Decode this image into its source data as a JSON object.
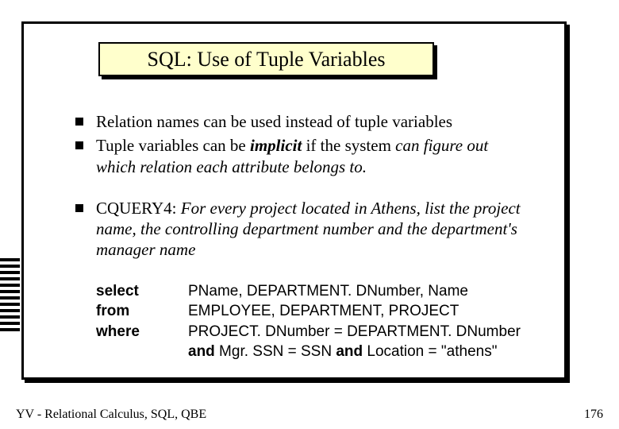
{
  "title": "SQL: Use of Tuple Variables",
  "bullets": {
    "b1": "Relation names can be used instead of tuple variables",
    "b2a": "Tuple variables can be ",
    "b2b": "implicit",
    "b2c": "  if the system ",
    "b2d": "can figure out which relation each attribute belongs to.",
    "b3a": "CQUERY4:   ",
    "b3b": "For every project located in Athens, list the project name, the controlling department number  and the department's manager name"
  },
  "sql": {
    "k_select": "select",
    "k_from": "from",
    "k_where": "where",
    "v_select": "PName, DEPARTMENT. DNumber, Name",
    "v_from": "EMPLOYEE, DEPARTMENT, PROJECT",
    "v_where1": "PROJECT. DNumber = DEPARTMENT. DNumber",
    "and1": "and",
    "v_where2": "  Mgr. SSN = SSN ",
    "and2": "and",
    "v_where3": "  Location = \"athens\""
  },
  "footer": {
    "left": "YV  -  Relational Calculus, SQL, QBE",
    "right": "176"
  }
}
